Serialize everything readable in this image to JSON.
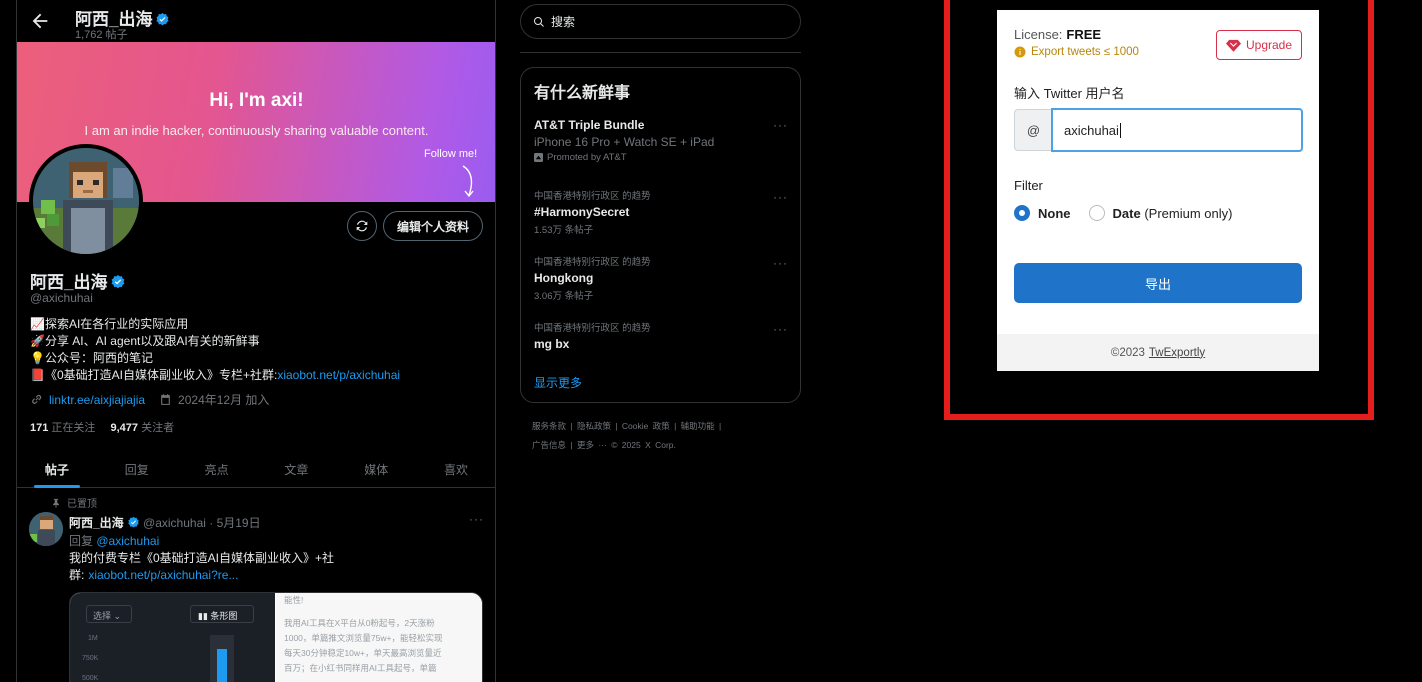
{
  "profile": {
    "header_name": "阿西_出海",
    "post_count": "1,762 帖子",
    "banner_title": "Hi, I'm axi!",
    "banner_subtitle": "I am an indie hacker, continuously sharing valuable content.",
    "banner_follow": "Follow me!",
    "edit_button": "编辑个人资料",
    "name": "阿西_出海",
    "handle": "@axichuhai",
    "bio": [
      {
        "emoji": "📈",
        "text": "探索AI在各行业的实际应用"
      },
      {
        "emoji": "🚀",
        "text": "分享 AI、AI agent以及跟AI有关的新鲜事"
      },
      {
        "emoji": "💡",
        "text": "公众号：阿西的笔记"
      },
      {
        "emoji": "📕",
        "text": "《0基础打造AI自媒体副业收入》专栏+社群:",
        "link": "xiaobot.net/p/axichuhai"
      }
    ],
    "website": "linktr.ee/aixjiajiajia",
    "joined": "2024年12月 加入",
    "following_count": "171",
    "following_label": "正在关注",
    "followers_count": "9,477",
    "followers_label": "关注者",
    "tabs": [
      "帖子",
      "回复",
      "亮点",
      "文章",
      "媒体",
      "喜欢"
    ],
    "pinned_label": "已置顶",
    "tweet": {
      "name": "阿西_出海",
      "handle_date": "@axichuhai · 5月19日",
      "reply_prefix": "回复",
      "reply_to": "@axichuhai",
      "text_line1": "我的付费专栏《0基础打造AI自媒体副业收入》+社",
      "text_line2_prefix": "群:",
      "text_link": "xiaobot.net/p/axichuhai?re...",
      "media_left_select": "选择",
      "media_left_chart": "条形图",
      "media_left_ticks": [
        "1M",
        "750K",
        "500K"
      ],
      "media_right_lines": [
        "能性!",
        "我用AI工具在X平台从0粉起号，2天涨粉",
        "1000，单篇推文浏览量75w+，能轻松实现",
        "每天30分钟稳定10w+，单天最高浏览量近",
        "百万；在小红书同样用AI工具起号，单篇"
      ]
    }
  },
  "sidebar": {
    "search_placeholder": "搜索",
    "news_title": "有什么新鲜事",
    "ad": {
      "title": "AT&T Triple Bundle",
      "subtitle": "iPhone 16 Pro + Watch SE + iPad",
      "promoted": "Promoted by AT&T"
    },
    "trends": [
      {
        "context": "中国香港特别行政区 的趋势",
        "name": "#HarmonySecret",
        "count": "1.53万 条帖子"
      },
      {
        "context": "中国香港特别行政区 的趋势",
        "name": "Hongkong",
        "count": "3.06万 条帖子"
      },
      {
        "context": "中国香港特别行政区 的趋势",
        "name": "mg bx",
        "count": ""
      }
    ],
    "show_more": "显示更多",
    "footer_line1": [
      "服务条款",
      "隐私政策",
      "Cookie 政策",
      "辅助功能"
    ],
    "footer_line2": [
      "广告信息",
      "更多 ···",
      "© 2025 X Corp."
    ]
  },
  "exporter": {
    "license_label": "License:",
    "license_value": "FREE",
    "export_limit": "Export tweets ≤ 1000",
    "upgrade_label": "Upgrade",
    "username_label": "输入 Twitter 用户名",
    "at_symbol": "@",
    "username_value": "axichuhai",
    "filter_label": "Filter",
    "filter_options": [
      {
        "label": "None",
        "suffix": "",
        "selected": true
      },
      {
        "label": "Date",
        "suffix": "(Premium only)",
        "selected": false
      }
    ],
    "export_button": "导出",
    "footer_copy": "©2023",
    "footer_link": "TwExportly",
    "frame_color": "#e51d1d",
    "accent_color": "#1f74c9"
  }
}
